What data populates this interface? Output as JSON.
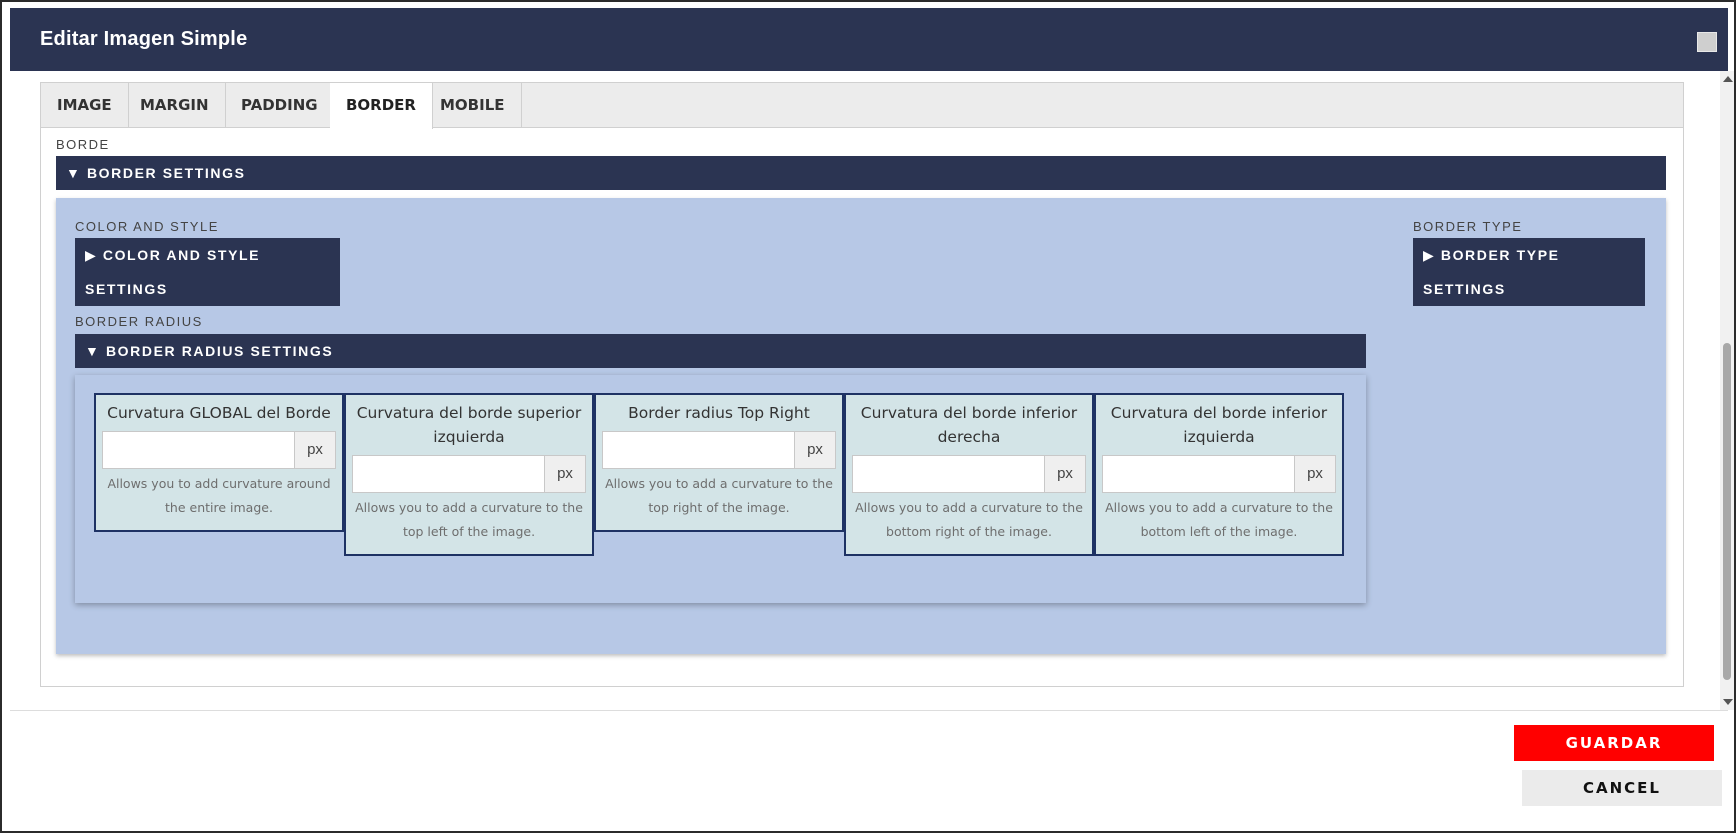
{
  "modal": {
    "title": "Editar Imagen Simple"
  },
  "tabs": [
    {
      "label": "IMAGE",
      "active": false
    },
    {
      "label": "MARGIN",
      "active": false
    },
    {
      "label": "PADDING",
      "active": false
    },
    {
      "label": "BORDER",
      "active": true
    },
    {
      "label": "MOBILE",
      "active": false
    }
  ],
  "border": {
    "section_label": "BORDE",
    "settings_toggle": "▼ BORDER SETTINGS",
    "color_style": {
      "label": "COLOR AND STYLE",
      "toggle": "▶ COLOR AND STYLE SETTINGS"
    },
    "border_type": {
      "label": "BORDER TYPE",
      "toggle": "▶ BORDER TYPE SETTINGS"
    },
    "radius": {
      "label": "BORDER RADIUS",
      "toggle": "▼ BORDER RADIUS SETTINGS",
      "fields": [
        {
          "title": "Curvatura GLOBAL del Borde",
          "value": "",
          "unit": "px",
          "help": "Allows you to add curvature around the entire image."
        },
        {
          "title": "Curvatura del borde superior izquierda",
          "value": "",
          "unit": "px",
          "help": "Allows you to add a curvature to the top left of the image."
        },
        {
          "title": "Border radius Top Right",
          "value": "",
          "unit": "px",
          "help": "Allows you to add a curvature to the top right of the image."
        },
        {
          "title": "Curvatura del borde inferior derecha",
          "value": "",
          "unit": "px",
          "help": "Allows you to add a curvature to the bottom right of the image."
        },
        {
          "title": "Curvatura del borde inferior izquierda",
          "value": "",
          "unit": "px",
          "help": "Allows you to add a curvature to the bottom left of the image."
        }
      ]
    }
  },
  "footer": {
    "save_label": "GUARDAR",
    "cancel_label": "CANCEL"
  },
  "colors": {
    "header_bg": "#2b3452",
    "panel_blue": "#b7c8e6",
    "card_bg": "#d3e4e7",
    "card_border": "#1e3264",
    "save_bg": "#ff0000"
  }
}
